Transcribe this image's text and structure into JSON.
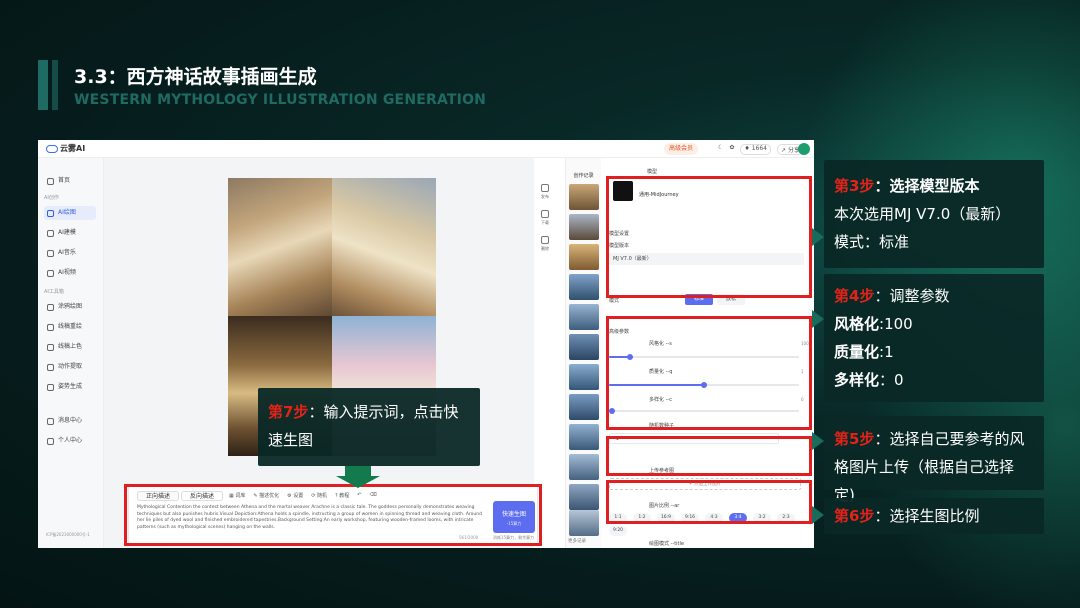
{
  "slide": {
    "title": "3.3：西方神话故事插画生成",
    "subtitle": "WESTERN MYTHOLOGY ILLUSTRATION GENERATION"
  },
  "app": {
    "brand": "云雾AI",
    "vip_label": "高级会员",
    "points": "1664",
    "share_label": "分享",
    "sidebar": {
      "home": "首页",
      "group_ai": "AI创作",
      "ai_draw": "AI绘图",
      "ai_model": "AI建模",
      "ai_music": "AI音乐",
      "ai_video": "AI视频",
      "group_tools": "AI工具箱",
      "sketch_draw": "涂鸦绘图",
      "line_art": "线稿重绘",
      "line_color": "线稿上色",
      "motion": "动作提取",
      "pose": "姿势生成",
      "messages": "消息中心",
      "profile": "个人中心",
      "footer": "ICP备2023000000号-1"
    },
    "tools": {
      "publish": "发布",
      "download": "下载",
      "delete": "删除"
    },
    "prompt": {
      "tab_positive": "正向描述",
      "tab_negative": "反向描述",
      "tool_lexicon": "词库",
      "tool_optimize": "描述优化",
      "tool_settings": "设置",
      "tool_random": "随机",
      "tool_tutorial": "教程",
      "text": "Mythological Contention the contest between Athena and the mortal weaver Arachne is a classic tale. The goddess personally demonstrates weaving techniques but also punishes hubris.Visual Depiction:Athena holds a spindle, instructing a group of women in spinning thread and weaving cloth. Around her lie piles of dyed wool and finished embroidered tapestries.Background Setting:An early workshop, featuring wooden-framed looms, with intricate patterns (such as mythological scenes) hanging on the walls.",
      "count": "561/2000",
      "generate_label": "快速生图",
      "generate_sub": "-15算力",
      "generate_note": "消耗15算力，剩余算力"
    },
    "history": {
      "title": "创作记录",
      "more": "更多记录"
    },
    "right": {
      "model_section": "模型",
      "model_name": "通用-MidJourney",
      "model_settings": "模型设置",
      "model_version_label": "模型版本",
      "model_version_value": "MJ V7.0（最新）",
      "mode_label": "模式",
      "mode_standard": "标准",
      "mode_relax": "放松",
      "advanced": "高级参数",
      "stylize_label": "风格化 --s",
      "stylize_value": "100",
      "quality_label": "质量化 --q",
      "quality_value": "1",
      "chaos_label": "多样化 --c",
      "chaos_value": "0",
      "seed_label": "随机数种子",
      "seed_value": "-1",
      "upload_label": "上传参考图",
      "upload_button": "+ 点击上传图片",
      "ratio_label": "图片比例 --ar",
      "ratios": [
        "1:1",
        "1:2",
        "16:9",
        "9:16",
        "4:3",
        "3:4",
        "3:2",
        "2:3",
        "9:20"
      ],
      "selected_ratio": "3:4",
      "draw_mode_label": "绘图模式 --title"
    }
  },
  "callouts": {
    "step3_head": "第3步",
    "step3_title": "：选择模型版本",
    "step3_line1": "本次选用MJ V7.0（最新）",
    "step3_line2": "模式：标准",
    "step4_head": "第4步",
    "step4_title": "：调整参数",
    "step4_l1_k": "风格化",
    "step4_l1_v": ":100",
    "step4_l2_k": "质量化",
    "step4_l2_v": ":1",
    "step4_l3_k": "多样化",
    "step4_l3_v": "：0",
    "step5_head": "第5步",
    "step5_text": "：选择自己要参考的风格图片上传（根据自己选择定)",
    "step6_head": "第6步",
    "step6_text": "：选择生图比例",
    "step7_head": "第7步",
    "step7_text": "：输入提示词，点击快速生图"
  },
  "colors": {
    "accent_red": "#e2231a",
    "brand_blue": "#5c6df0",
    "bg_teal": "#082826"
  }
}
